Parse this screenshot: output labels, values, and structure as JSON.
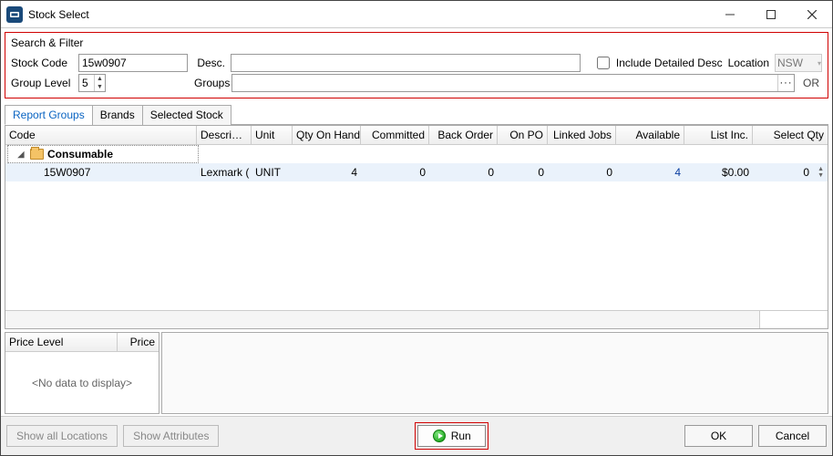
{
  "title": "Stock Select",
  "filter": {
    "legend": "Search & Filter",
    "stock_code_label": "Stock Code",
    "stock_code_value": "15w0907",
    "desc_label": "Desc.",
    "desc_value": "",
    "include_detailed_label": "Include Detailed Desc",
    "location_label": "Location",
    "location_value": "NSW",
    "group_level_label": "Group Level",
    "group_level_value": "5",
    "groups_label": "Groups",
    "groups_value": "",
    "or_label": "OR"
  },
  "tabs": [
    {
      "label": "Report Groups"
    },
    {
      "label": "Brands"
    },
    {
      "label": "Selected Stock"
    }
  ],
  "columns": {
    "code": "Code",
    "description": "Descri…",
    "unit": "Unit",
    "qty_on_hand": "Qty On Hand",
    "committed": "Committed",
    "back_order": "Back Order",
    "on_po": "On PO",
    "linked_jobs": "Linked Jobs",
    "available": "Available",
    "list_inc": "List Inc.",
    "select_qty": "Select Qty"
  },
  "group_row": {
    "label": "Consumable"
  },
  "data_row": {
    "code": "15W0907",
    "description": "Lexmark (",
    "unit": "UNIT",
    "qty_on_hand": "4",
    "committed": "0",
    "back_order": "0",
    "on_po": "0",
    "linked_jobs": "0",
    "available": "4",
    "list_inc": "$0.00",
    "select_qty": "0"
  },
  "price_panel": {
    "col1": "Price Level",
    "col2": "Price",
    "empty": "<No data to display>"
  },
  "footer": {
    "show_all_locations": "Show all Locations",
    "show_attributes": "Show Attributes",
    "run": "Run",
    "ok": "OK",
    "cancel": "Cancel"
  }
}
